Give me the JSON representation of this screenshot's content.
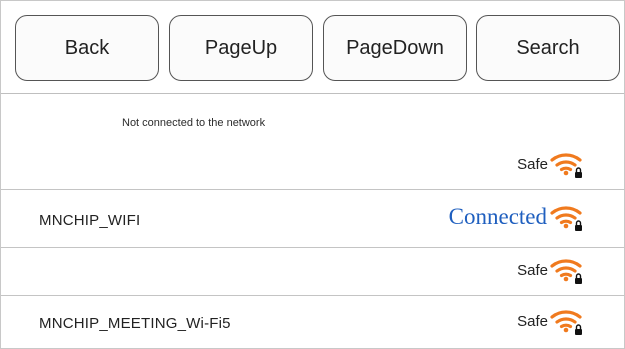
{
  "toolbar": {
    "back_label": "Back",
    "pageup_label": "PageUp",
    "pagedown_label": "PageDown",
    "search_label": "Search"
  },
  "status": {
    "text": "Not connected to the network",
    "safe_label": "Safe"
  },
  "networks": [
    {
      "name": "MNCHIP_WIFI",
      "state_label": "Connected",
      "icon": "wifi-locked-icon"
    },
    {
      "name": "",
      "state_label": "Safe",
      "icon": "wifi-locked-icon"
    },
    {
      "name": "MNCHIP_MEETING_Wi-Fi5",
      "state_label": "Safe",
      "icon": "wifi-locked-icon"
    }
  ],
  "colors": {
    "wifi": "#f07a1e",
    "connected": "#1f5fbf"
  }
}
